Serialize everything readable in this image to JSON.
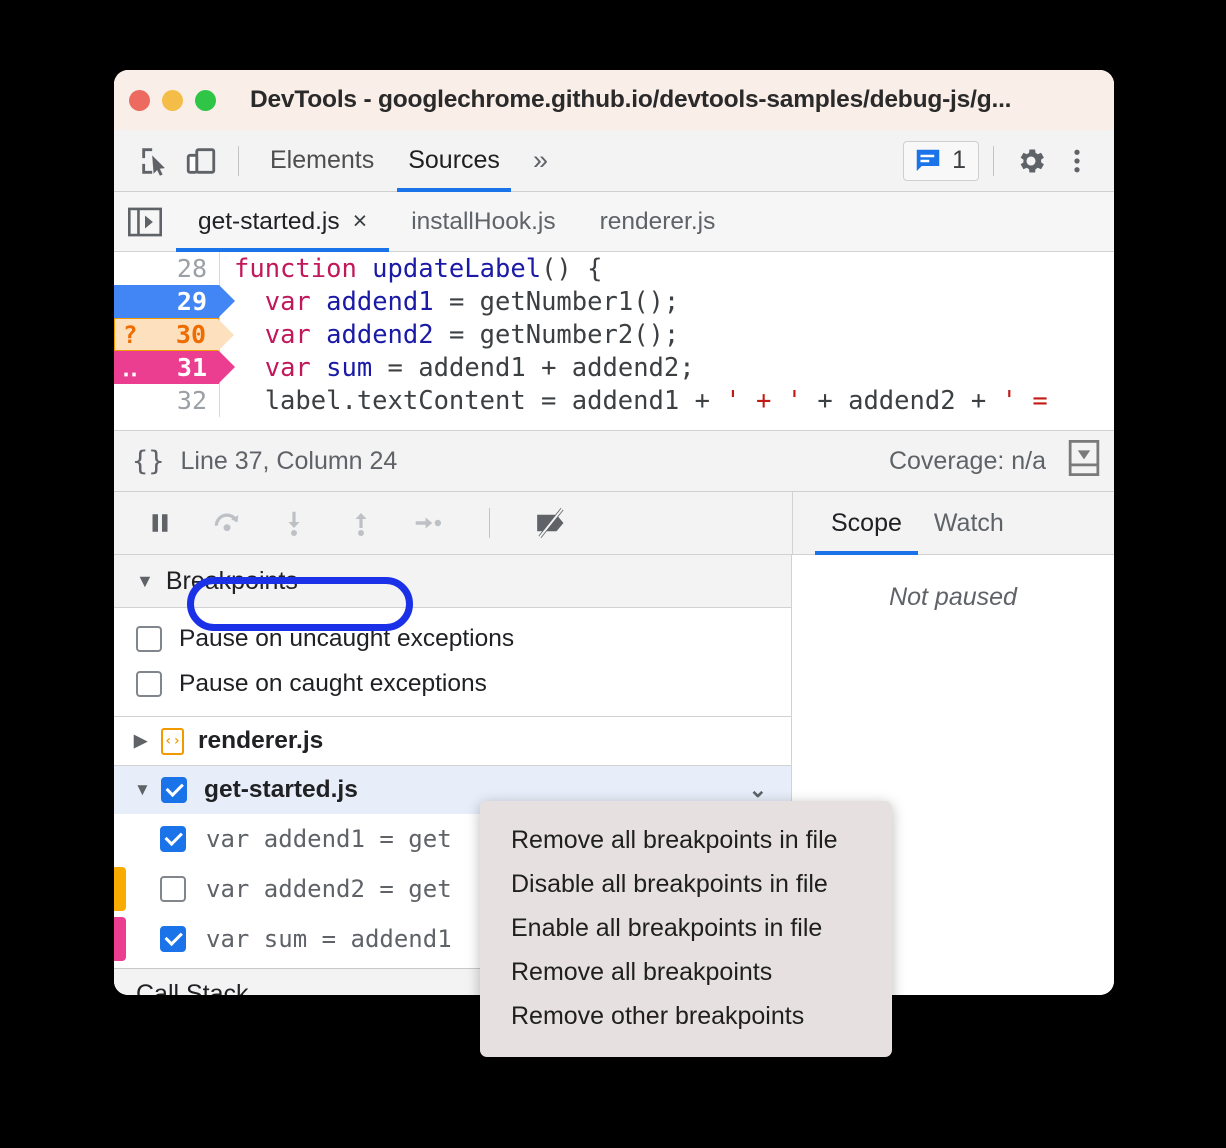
{
  "window": {
    "title": "DevTools - googlechrome.github.io/devtools-samples/debug-js/g...",
    "traffic_lights": [
      "close-red",
      "minimize-yellow",
      "maximize-green"
    ]
  },
  "main_toolbar": {
    "inspect_icon": "inspect-element-icon",
    "device_icon": "device-toolbar-icon",
    "panels": [
      {
        "label": "Elements",
        "active": false
      },
      {
        "label": "Sources",
        "active": true
      }
    ],
    "more_panels": "»",
    "message_badge": {
      "icon": "console-message-icon",
      "count": "1"
    },
    "settings_icon": "gear-icon",
    "menu_icon": "more-vertical-icon"
  },
  "editor_tabs": {
    "navigator_toggle_icon": "show-navigator-icon",
    "tabs": [
      {
        "label": "get-started.js",
        "active": true,
        "closable": true,
        "close_glyph": "×"
      },
      {
        "label": "installHook.js",
        "active": false,
        "closable": false
      },
      {
        "label": "renderer.js",
        "active": false,
        "closable": false
      }
    ]
  },
  "code": {
    "lines": [
      {
        "number": "28",
        "marker": "none",
        "tokens": [
          {
            "t": "function ",
            "c": "kw"
          },
          {
            "t": "updateLabel",
            "c": "fn"
          },
          {
            "t": "() {",
            "c": "pun"
          }
        ]
      },
      {
        "number": "29",
        "marker": "breakpoint",
        "marker_glyph": "",
        "tokens": [
          {
            "t": "  ",
            "c": "pun"
          },
          {
            "t": "var ",
            "c": "kw"
          },
          {
            "t": "addend1",
            "c": "id"
          },
          {
            "t": " = getNumber1();",
            "c": "pun"
          }
        ]
      },
      {
        "number": "30",
        "marker": "conditional",
        "marker_glyph": "?",
        "tokens": [
          {
            "t": "  ",
            "c": "pun"
          },
          {
            "t": "var ",
            "c": "kw"
          },
          {
            "t": "addend2",
            "c": "id"
          },
          {
            "t": " = getNumber2();",
            "c": "pun"
          }
        ]
      },
      {
        "number": "31",
        "marker": "logpoint",
        "marker_glyph": "‥",
        "tokens": [
          {
            "t": "  ",
            "c": "pun"
          },
          {
            "t": "var ",
            "c": "kw"
          },
          {
            "t": "sum",
            "c": "id"
          },
          {
            "t": " = addend1 + addend2;",
            "c": "pun"
          }
        ]
      },
      {
        "number": "32",
        "marker": "none",
        "tokens": [
          {
            "t": "  label.textContent = addend1 + ",
            "c": "pun"
          },
          {
            "t": "' + '",
            "c": "str"
          },
          {
            "t": " + addend2 + ",
            "c": "pun"
          },
          {
            "t": "' =",
            "c": "str"
          }
        ]
      }
    ],
    "colors": {
      "breakpoint_blue": "#4285f4",
      "conditional_orange": "#f29900",
      "logpoint_pink": "#eb3e90"
    }
  },
  "status_bar": {
    "format_icon": "{}",
    "position": "Line 37, Column 24",
    "coverage": "Coverage: n/a",
    "drawer_icon": "show-drawer-icon"
  },
  "debug_toolbar": {
    "buttons": [
      {
        "name": "pause-script-button",
        "icon": "pause-icon"
      },
      {
        "name": "step-over-button",
        "icon": "step-over-icon"
      },
      {
        "name": "step-into-button",
        "icon": "step-into-icon"
      },
      {
        "name": "step-out-button",
        "icon": "step-out-icon"
      },
      {
        "name": "step-button",
        "icon": "step-icon"
      },
      {
        "name": "deactivate-breakpoints-button",
        "icon": "deactivate-breakpoints-icon"
      }
    ]
  },
  "side_tabs": [
    {
      "label": "Scope",
      "active": true
    },
    {
      "label": "Watch",
      "active": false
    }
  ],
  "scope_panel": {
    "empty_text": "Not paused"
  },
  "breakpoints_panel": {
    "section_title": "Breakpoints",
    "collapse_glyph": "▼",
    "options": [
      {
        "label": "Pause on uncaught exceptions",
        "checked": false
      },
      {
        "label": "Pause on caught exceptions",
        "checked": false
      }
    ],
    "files": [
      {
        "name": "renderer.js",
        "expanded": false,
        "expand_glyph": "▶",
        "checkbox": "none",
        "file_icon": "js-file-icon",
        "icon_glyph": "‹›",
        "selected": false,
        "breakpoints": []
      },
      {
        "name": "get-started.js",
        "expanded": true,
        "expand_glyph": "▼",
        "checkbox": "checked",
        "selected": true,
        "row_menu_glyph": "⌄",
        "breakpoints": [
          {
            "label": "var addend1 = get",
            "checked": true,
            "bar_color": "none"
          },
          {
            "label": "var addend2 = get",
            "checked": false,
            "bar_color": "#f9ab00"
          },
          {
            "label": "var sum = addend1",
            "checked": true,
            "bar_color": "#eb3e90"
          }
        ]
      }
    ],
    "call_stack_title": "Call Stack"
  },
  "context_menu": {
    "items": [
      "Remove all breakpoints in file",
      "Disable all breakpoints in file",
      "Enable all breakpoints in file",
      "Remove all breakpoints",
      "Remove other breakpoints"
    ]
  },
  "annotation": {
    "target": "Breakpoints",
    "color": "#1a31e8"
  }
}
